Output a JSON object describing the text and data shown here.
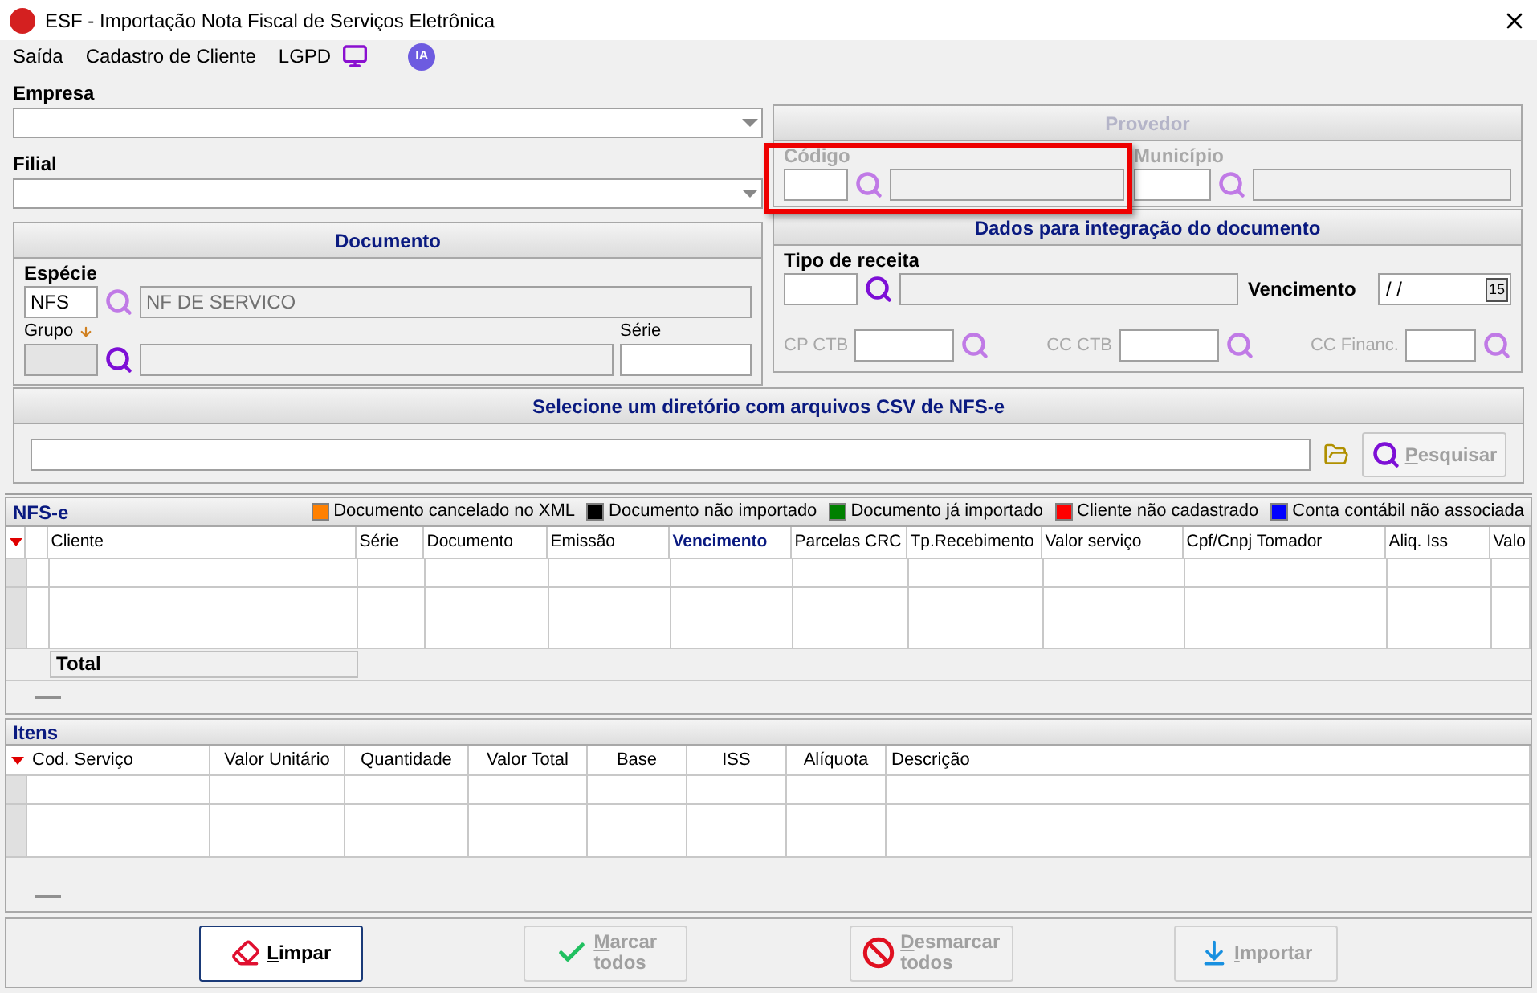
{
  "window": {
    "title": "ESF - Importação Nota Fiscal de Serviços Eletrônica"
  },
  "menu": [
    {
      "label": "Saída"
    },
    {
      "label": "Cadastro de Cliente"
    },
    {
      "label": "LGPD"
    }
  ],
  "ia_badge": "IA",
  "empresa": {
    "label": "Empresa"
  },
  "filial": {
    "label": "Filial"
  },
  "documento": {
    "title": "Documento",
    "especie_label": "Espécie",
    "especie_code": "NFS",
    "especie_desc": "NF DE SERVICO",
    "grupo_label": "Grupo",
    "serie_label": "Série"
  },
  "provedor": {
    "title": "Provedor",
    "disabled": true,
    "codigo_label": "Código",
    "municipio_label": "Município"
  },
  "integracao": {
    "title": "Dados para integração do documento",
    "tipo_label": "Tipo de receita",
    "vencimento_label": "Vencimento",
    "vencimento_value": " / /",
    "calendar": "15",
    "accounts": [
      {
        "label": "CP CTB",
        "disabled": true
      },
      {
        "label": "CC CTB",
        "disabled": true
      },
      {
        "label": "CC Financ.",
        "disabled": true
      }
    ]
  },
  "diretorio": {
    "title": "Selecione um diretório com arquivos CSV de NFS-e",
    "search": {
      "label": "Pesquisar",
      "disabled": true
    }
  },
  "nfse": {
    "title": "NFS-e",
    "legend": [
      {
        "label": "Documento cancelado no XML",
        "color": "#ff8000"
      },
      {
        "label": "Documento não importado",
        "color": "#000000"
      },
      {
        "label": "Documento já importado",
        "color": "#008000"
      },
      {
        "label": "Cliente não cadastrado",
        "color": "#ff0000"
      },
      {
        "label": "Conta contábil não associada",
        "color": "#0000ff"
      }
    ],
    "columns": [
      {
        "label": "Cliente",
        "highlighted": false
      },
      {
        "label": "Série",
        "highlighted": false
      },
      {
        "label": "Documento",
        "highlighted": false
      },
      {
        "label": "Emissão",
        "highlighted": false
      },
      {
        "label": "Vencimento",
        "highlighted": true
      },
      {
        "label": "Parcelas CRC",
        "highlighted": false
      },
      {
        "label": "Tp.Recebimento",
        "highlighted": false
      },
      {
        "label": "Valor serviço",
        "highlighted": false
      },
      {
        "label": "Cpf/Cnpj Tomador",
        "highlighted": false
      },
      {
        "label": "Aliq. Iss",
        "highlighted": false
      },
      {
        "label": "Valo",
        "highlighted": false
      }
    ],
    "total": "Total"
  },
  "itens": {
    "title": "Itens",
    "columns": [
      "Cod. Serviço",
      "Valor Unitário",
      "Quantidade",
      "Valor Total",
      "Base",
      "ISS",
      "Alíquota",
      "Descrição"
    ]
  },
  "buttons": [
    {
      "label": "Limpar",
      "kind": "clear",
      "disabled": false
    },
    {
      "label": "Marcar todos",
      "kind": "check",
      "disabled": true
    },
    {
      "label": "Desmarcar todos",
      "kind": "uncheck",
      "disabled": true
    },
    {
      "label": "Importar",
      "kind": "import",
      "disabled": true
    }
  ]
}
